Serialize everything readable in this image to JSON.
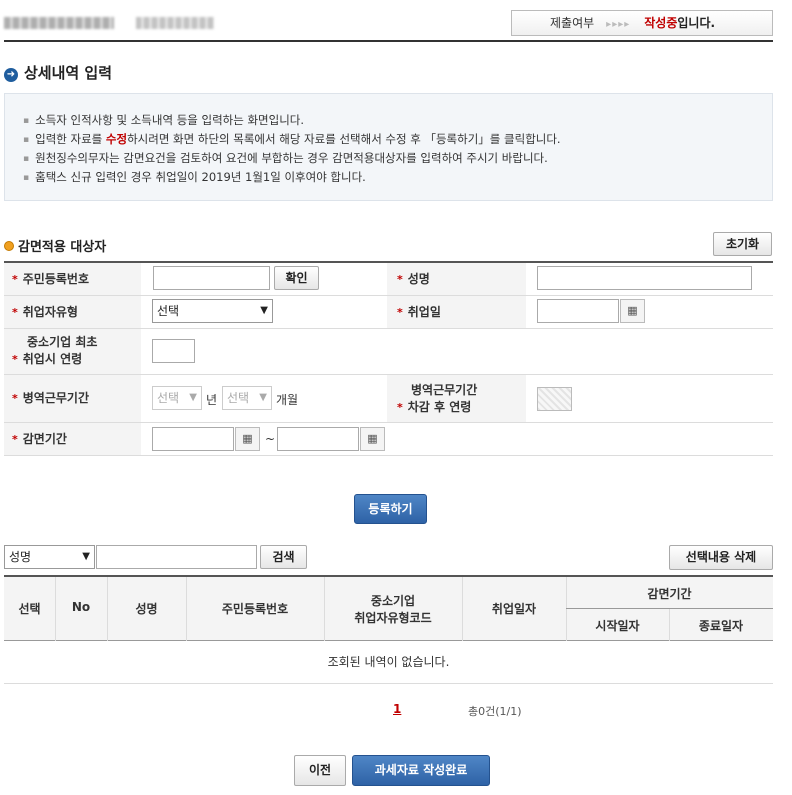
{
  "header": {
    "status_label": "제출여부",
    "status_arrows": "▸▸▸▸",
    "status_value_red": "작성중",
    "status_value_suffix": "입니다."
  },
  "section": {
    "title": "상세내역 입력",
    "notes": {
      "line1": "소득자 인적사항 및 소득내역 등을 입력하는 화면입니다.",
      "line2_pre": "입력한 자료를 ",
      "line2_red": "수정",
      "line2_post": "하시려면 화면 하단의 목록에서 해당 자료를 선택해서 수정 후 「등록하기」를 클릭합니다.",
      "line3": "원천징수의무자는 감면요건을 검토하여 요건에 부합하는 경우 감면적용대상자를 입력하여 주시기 바랍니다.",
      "line4": "홈택스 신규 입력인 경우 취업일이 2019년 1월1일 이후여야 합니다."
    }
  },
  "form": {
    "title": "감면적용 대상자",
    "reset_label": "초기화",
    "required_mark": "*",
    "rrn_label": "주민등록번호",
    "confirm_label": "확인",
    "name_label": "성명",
    "emp_type_label": "취업자유형",
    "emp_type_value": "선택",
    "emp_date_label": "취업일",
    "sme_age_label_1": "중소기업 최초",
    "sme_age_label_2": "취업시 연령",
    "military_label": "병역근무기간",
    "military_year_value": "선택",
    "year_unit": "년",
    "military_month_value": "선택",
    "month_unit": "개월",
    "military_age_label_1": "병역근무기간",
    "military_age_label_2": "차감 후 연령",
    "reduction_label": "감면기간",
    "tilde": "~",
    "register_label": "등록하기"
  },
  "search": {
    "field_value": "성명",
    "button_label": "검색",
    "delete_label": "선택내용 삭제"
  },
  "table": {
    "headers": {
      "select": "선택",
      "no": "No",
      "name": "성명",
      "rrn": "주민등록번호",
      "sme_code_1": "중소기업",
      "sme_code_2": "취업자유형코드",
      "emp_date": "취업일자",
      "period": "감면기간",
      "start": "시작일자",
      "end": "종료일자"
    },
    "empty_message": "조회된 내역이 없습니다."
  },
  "pagination": {
    "current_page": "1",
    "summary": "총0건(1/1)"
  },
  "footer": {
    "prev_label": "이전",
    "complete_label": "과세자료 작성완료"
  },
  "colors": {
    "accent_red": "#c00000",
    "primary_blue": "#2e62a6",
    "info_bg": "#f3f6f9"
  }
}
